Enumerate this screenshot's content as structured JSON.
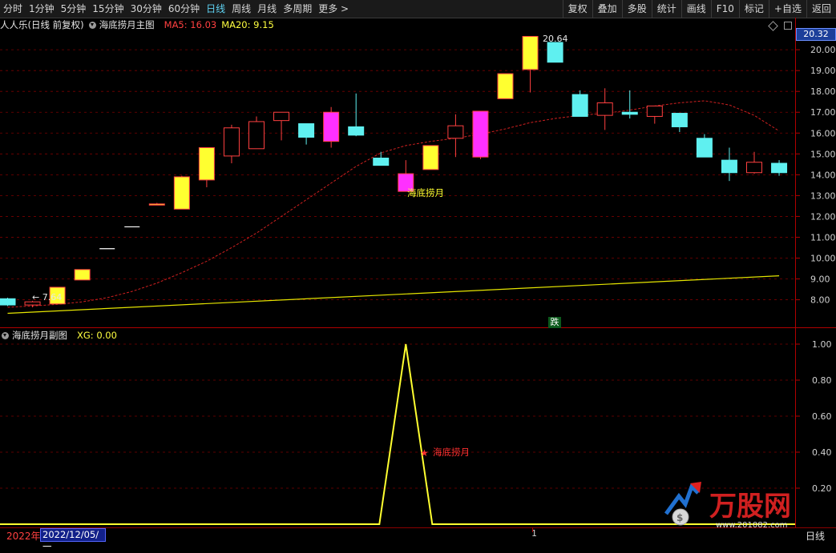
{
  "toolbar": {
    "periods": [
      "分时",
      "1分钟",
      "5分钟",
      "15分钟",
      "30分钟",
      "60分钟",
      "日线",
      "周线",
      "月线",
      "多周期",
      "更多 >"
    ],
    "active_period": "日线",
    "actions": [
      "复权",
      "叠加",
      "多股",
      "统计",
      "画线",
      "F10",
      "标记",
      "+自选",
      "返回"
    ]
  },
  "main_chart": {
    "title": "人人乐(日线 前复权)",
    "indicator_name": "海底捞月主图",
    "ma5_label": "MA5: 16.03",
    "ma20_label": "MA20: 9.15",
    "current_price": "20.32",
    "high_annotation": "20.64",
    "low_annotation": "7.64",
    "signal_label": "海底捞月",
    "drop_label": "跌",
    "y_ticks": [
      "20.00",
      "19.00",
      "18.00",
      "17.00",
      "16.00",
      "15.00",
      "14.00",
      "13.00",
      "12.00",
      "11.00",
      "10.00",
      "9.00",
      "8.00"
    ]
  },
  "sub_chart": {
    "indicator_name": "海底捞月副图",
    "xg_label": "XG: 0.00",
    "signal_label": "海底捞月",
    "y_ticks": [
      "1.00",
      "0.80",
      "0.60",
      "0.40",
      "0.20"
    ]
  },
  "bottom_bar": {
    "year": "2022年",
    "date": "2022/12/05/一",
    "divider_label": "1",
    "period": "日线"
  },
  "watermark": {
    "brand": "万股网",
    "url": "www.201082.com"
  },
  "colors": {
    "up_candle": "#ff4040",
    "down_candle": "#5ff0f0",
    "signal_yellow": "#ffff30",
    "signal_magenta": "#ff30ff",
    "ma_long": "#e6e600",
    "ma_dashed": "#d02020"
  },
  "chart_data": {
    "type": "candlestick",
    "candles": [
      {
        "o": 8.05,
        "c": 7.75,
        "h": 8.1,
        "l": 7.7,
        "style": "down"
      },
      {
        "o": 7.75,
        "c": 7.9,
        "h": 7.95,
        "l": 7.64,
        "style": "up"
      },
      {
        "o": 7.8,
        "c": 8.6,
        "h": 8.6,
        "l": 7.8,
        "style": "yellow"
      },
      {
        "o": 8.95,
        "c": 9.45,
        "h": 9.45,
        "l": 8.95,
        "style": "yellow"
      },
      {
        "o": 10.45,
        "c": 10.45,
        "h": 10.45,
        "l": 10.45,
        "style": "doji"
      },
      {
        "o": 11.5,
        "c": 11.5,
        "h": 11.5,
        "l": 11.5,
        "style": "doji"
      },
      {
        "o": 12.6,
        "c": 12.6,
        "h": 12.65,
        "l": 12.55,
        "style": "yellow"
      },
      {
        "o": 12.35,
        "c": 13.9,
        "h": 13.95,
        "l": 12.35,
        "style": "yellow"
      },
      {
        "o": 13.75,
        "c": 15.3,
        "h": 15.3,
        "l": 13.4,
        "style": "yellow"
      },
      {
        "o": 14.9,
        "c": 16.25,
        "h": 16.4,
        "l": 14.55,
        "style": "up"
      },
      {
        "o": 15.25,
        "c": 16.55,
        "h": 16.8,
        "l": 15.25,
        "style": "up"
      },
      {
        "o": 16.6,
        "c": 17.0,
        "h": 17.0,
        "l": 15.65,
        "style": "up"
      },
      {
        "o": 16.45,
        "c": 15.8,
        "h": 16.45,
        "l": 15.45,
        "style": "down"
      },
      {
        "o": 15.6,
        "c": 17.0,
        "h": 17.25,
        "l": 15.3,
        "style": "magenta"
      },
      {
        "o": 16.3,
        "c": 15.9,
        "h": 17.9,
        "l": 15.85,
        "style": "down"
      },
      {
        "o": 14.8,
        "c": 14.45,
        "h": 15.1,
        "l": 14.45,
        "style": "down"
      },
      {
        "o": 14.05,
        "c": 13.2,
        "h": 14.7,
        "l": 13.2,
        "style": "magenta"
      },
      {
        "o": 14.25,
        "c": 15.4,
        "h": 15.4,
        "l": 14.25,
        "style": "yellow"
      },
      {
        "o": 15.75,
        "c": 16.35,
        "h": 16.9,
        "l": 14.85,
        "style": "up"
      },
      {
        "o": 14.85,
        "c": 17.05,
        "h": 17.05,
        "l": 14.75,
        "style": "magenta"
      },
      {
        "o": 17.65,
        "c": 18.85,
        "h": 18.85,
        "l": 17.65,
        "style": "yellow"
      },
      {
        "o": 19.05,
        "c": 20.64,
        "h": 20.64,
        "l": 17.95,
        "style": "yellow"
      },
      {
        "o": 20.35,
        "c": 19.4,
        "h": 20.2,
        "l": 19.4,
        "style": "down"
      },
      {
        "o": 17.85,
        "c": 16.8,
        "h": 18.05,
        "l": 16.8,
        "style": "down"
      },
      {
        "o": 16.85,
        "c": 17.45,
        "h": 18.15,
        "l": 16.15,
        "style": "up"
      },
      {
        "o": 17.0,
        "c": 16.9,
        "h": 18.05,
        "l": 16.7,
        "style": "down"
      },
      {
        "o": 16.8,
        "c": 17.3,
        "h": 17.3,
        "l": 16.45,
        "style": "up"
      },
      {
        "o": 16.95,
        "c": 16.3,
        "h": 16.95,
        "l": 16.05,
        "style": "down"
      },
      {
        "o": 15.75,
        "c": 14.85,
        "h": 15.95,
        "l": 14.85,
        "style": "down"
      },
      {
        "o": 14.7,
        "c": 14.1,
        "h": 15.3,
        "l": 13.7,
        "style": "down"
      },
      {
        "o": 14.1,
        "c": 14.6,
        "h": 15.1,
        "l": 14.05,
        "style": "up"
      },
      {
        "o": 14.55,
        "c": 14.1,
        "h": 14.7,
        "l": 13.95,
        "style": "down"
      }
    ],
    "ma20": [
      7.64,
      7.7,
      7.78,
      7.9,
      8.1,
      8.4,
      8.8,
      9.3,
      9.85,
      10.5,
      11.2,
      12.0,
      12.8,
      13.6,
      14.4,
      15.05,
      15.4,
      15.6,
      15.75,
      15.95,
      16.2,
      16.5,
      16.7,
      16.85,
      16.95,
      17.1,
      17.3,
      17.45,
      17.55,
      17.35,
      16.85,
      16.1
    ],
    "ma_long": {
      "x": [
        0,
        31
      ],
      "y": [
        7.35,
        9.15
      ]
    },
    "y_range": [
      7.1,
      20.85
    ],
    "signal": {
      "x": 16,
      "y": 1
    },
    "sub_range": [
      0,
      1.0
    ]
  }
}
